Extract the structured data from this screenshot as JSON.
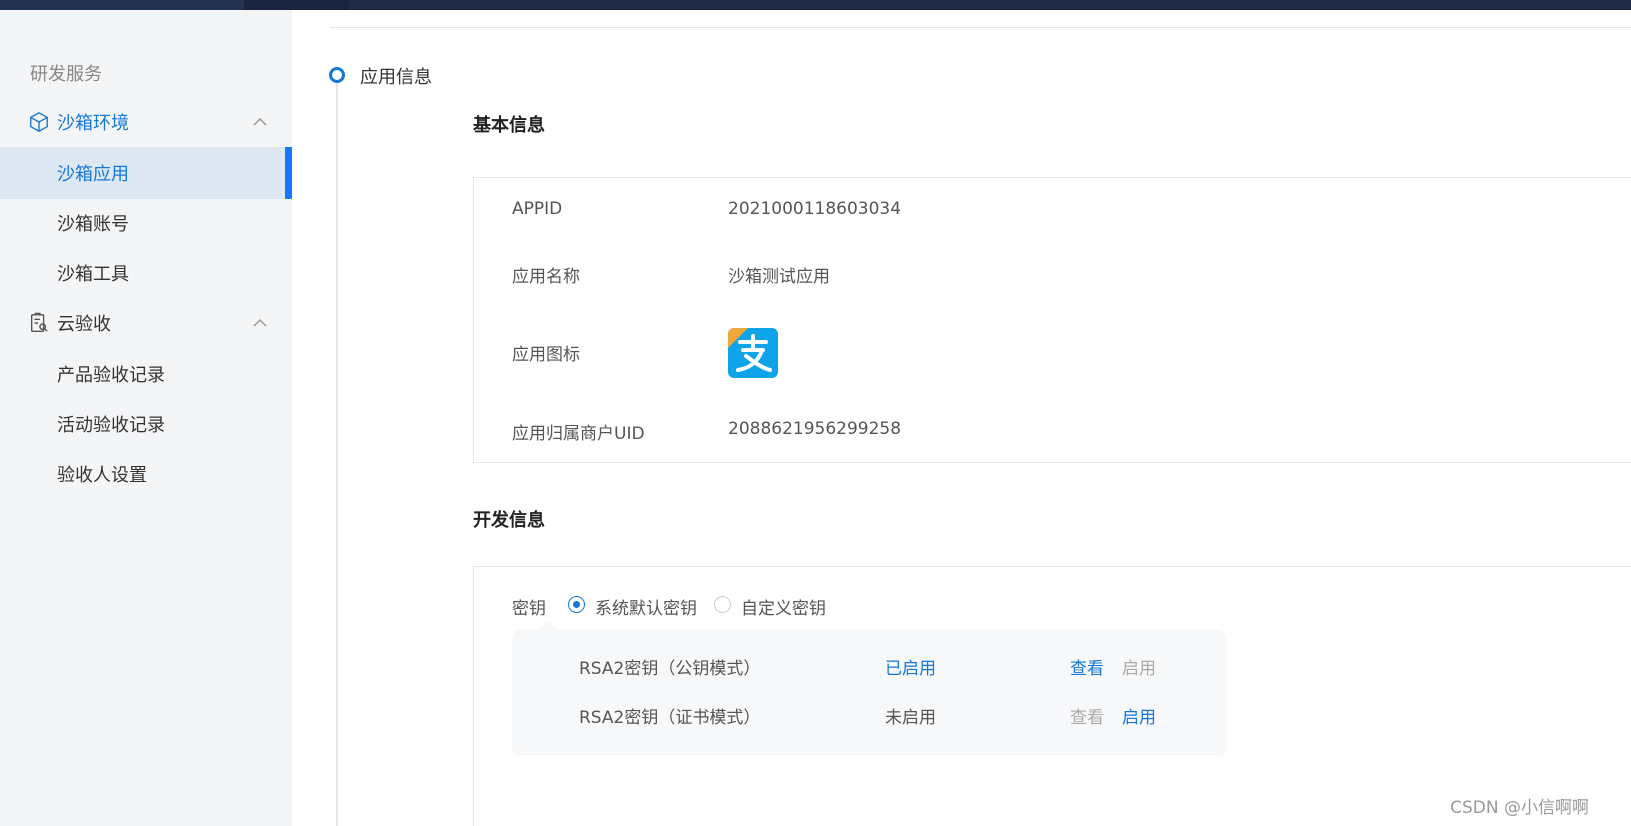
{
  "colors": {
    "accent": "#1677d6",
    "active_bar": "#1677ff",
    "sidebar_bg": "#f4f5f7",
    "active_item_bg": "#dde8f3",
    "topbar": "#1f2a44"
  },
  "sidebar": {
    "title": "研发服务",
    "groups": [
      {
        "label": "沙箱环境",
        "icon": "cube-icon",
        "expanded": true,
        "items": [
          {
            "label": "沙箱应用",
            "active": true
          },
          {
            "label": "沙箱账号",
            "active": false
          },
          {
            "label": "沙箱工具",
            "active": false
          }
        ]
      },
      {
        "label": "云验收",
        "icon": "clipboard-search-icon",
        "expanded": true,
        "items": [
          {
            "label": "产品验收记录",
            "active": false
          },
          {
            "label": "活动验收记录",
            "active": false
          },
          {
            "label": "验收人设置",
            "active": false
          }
        ]
      }
    ]
  },
  "main": {
    "step_label": "应用信息",
    "basic_info": {
      "title": "基本信息",
      "rows": [
        {
          "label": "APPID",
          "value": "2021000118603034"
        },
        {
          "label": "应用名称",
          "value": "沙箱测试应用"
        },
        {
          "label": "应用图标",
          "icon": "alipay-app-icon"
        },
        {
          "label": "应用归属商户UID",
          "value": "2088621956299258"
        }
      ]
    },
    "dev_info": {
      "title": "开发信息",
      "key_label": "密钥",
      "key_options": [
        {
          "label": "系统默认密钥",
          "selected": true
        },
        {
          "label": "自定义密钥",
          "selected": false
        }
      ],
      "keys": [
        {
          "name": "RSA2密钥（公钥模式）",
          "status": "已启用",
          "enabled": true,
          "view": "查看",
          "enable": "启用"
        },
        {
          "name": "RSA2密钥（证书模式）",
          "status": "未启用",
          "enabled": false,
          "view": "查看",
          "enable": "启用"
        }
      ]
    }
  },
  "watermark": "CSDN @小信啊啊"
}
